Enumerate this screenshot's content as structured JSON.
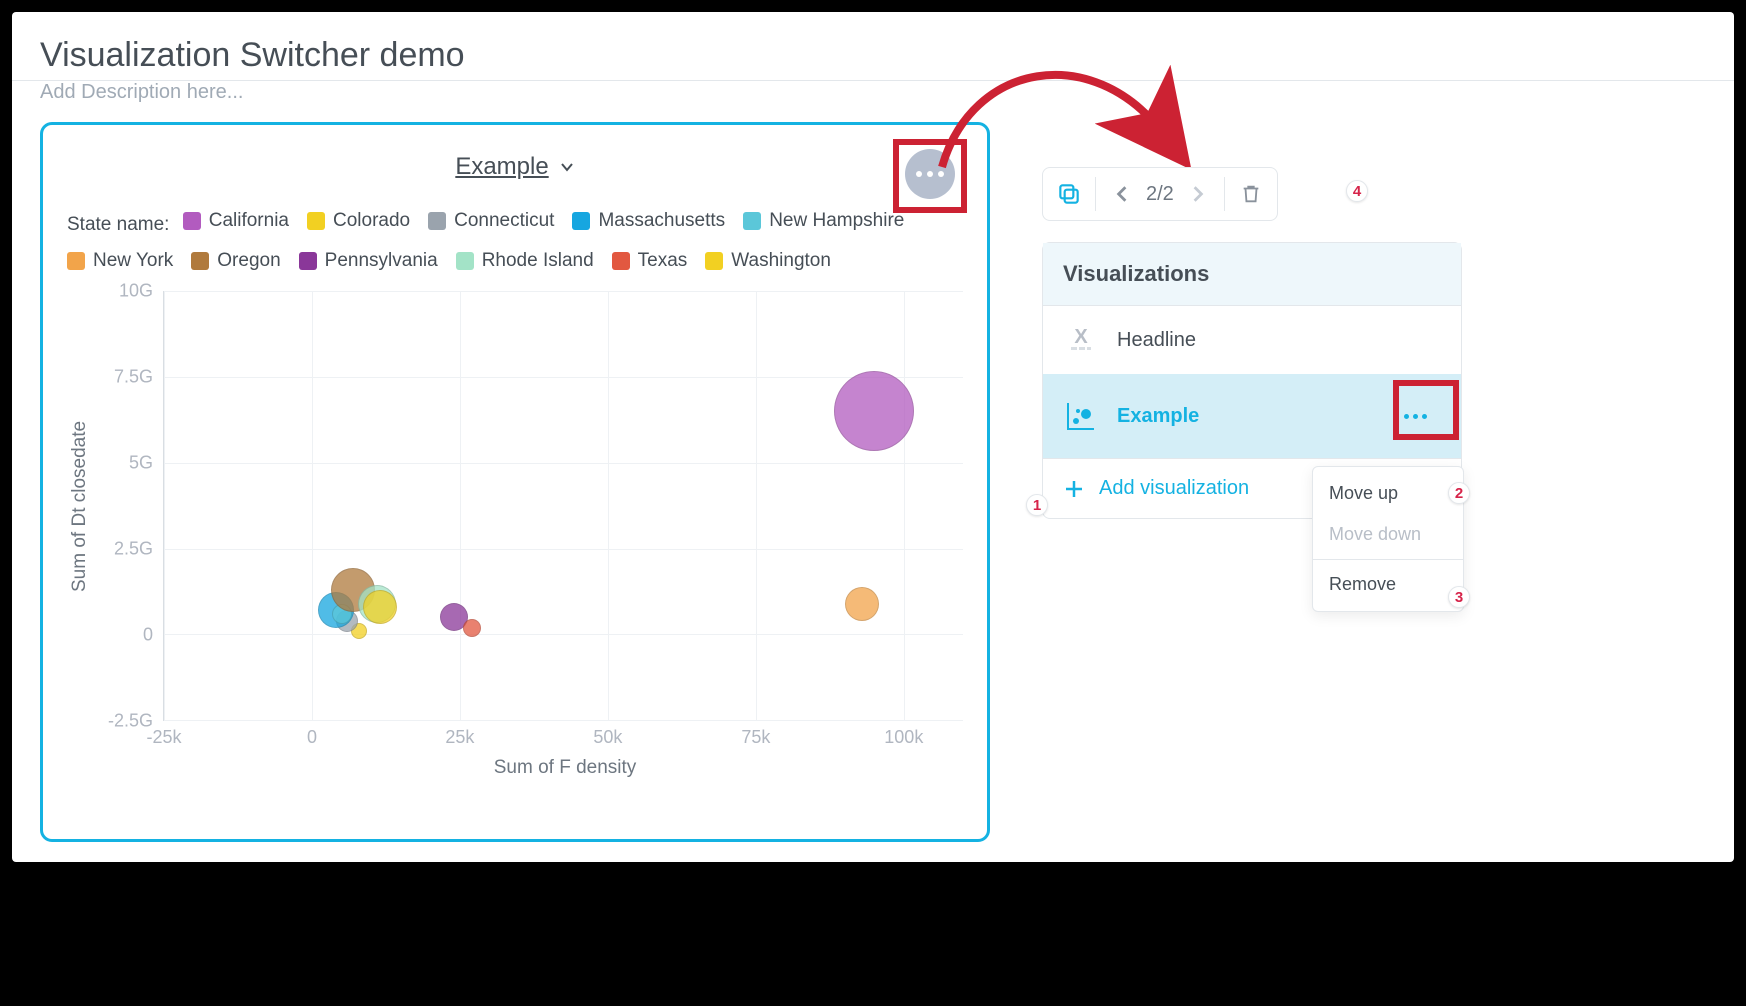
{
  "page": {
    "title": "Visualization Switcher demo",
    "description_placeholder": "Add Description here..."
  },
  "chartHeader": {
    "title": "Example"
  },
  "legend": {
    "label": "State name:",
    "items": [
      {
        "name": "California",
        "color": "#b25bbf"
      },
      {
        "name": "Colorado",
        "color": "#f2d022"
      },
      {
        "name": "Connecticut",
        "color": "#9aa3ad"
      },
      {
        "name": "Massachusetts",
        "color": "#16a6e0"
      },
      {
        "name": "New Hampshire",
        "color": "#5bc7d9"
      },
      {
        "name": "New York",
        "color": "#f2a44a"
      },
      {
        "name": "Oregon",
        "color": "#b07a3d"
      },
      {
        "name": "Pennsylvania",
        "color": "#8a3799"
      },
      {
        "name": "Rhode Island",
        "color": "#a3e3c7"
      },
      {
        "name": "Texas",
        "color": "#e25840"
      },
      {
        "name": "Washington",
        "color": "#f2d022"
      }
    ]
  },
  "toolbar": {
    "counter": "2/2"
  },
  "vizPanel": {
    "header": "Visualizations",
    "items": [
      {
        "label": "Headline",
        "type": "headline"
      },
      {
        "label": "Example",
        "type": "bubble",
        "active": true
      }
    ],
    "add_label": "Add visualization"
  },
  "contextMenu": {
    "move_up": "Move up",
    "move_down": "Move down",
    "remove": "Remove"
  },
  "callouts": {
    "c1": "1",
    "c2": "2",
    "c3": "3",
    "c4": "4"
  },
  "chart_data": {
    "type": "scatter",
    "title": "Example",
    "xlabel": "Sum of F density",
    "ylabel": "Sum of Dt closedate",
    "xlim": [
      -25000,
      110000
    ],
    "ylim": [
      -2500000000,
      10000000000
    ],
    "x_ticks": [
      {
        "v": -25000,
        "label": "-25k"
      },
      {
        "v": 0,
        "label": "0"
      },
      {
        "v": 25000,
        "label": "25k"
      },
      {
        "v": 50000,
        "label": "50k"
      },
      {
        "v": 75000,
        "label": "75k"
      },
      {
        "v": 100000,
        "label": "100k"
      }
    ],
    "y_ticks": [
      {
        "v": -2500000000,
        "label": "-2.5G"
      },
      {
        "v": 0,
        "label": "0"
      },
      {
        "v": 2500000000,
        "label": "2.5G"
      },
      {
        "v": 5000000000,
        "label": "5G"
      },
      {
        "v": 7500000000,
        "label": "7.5G"
      },
      {
        "v": 10000000000,
        "label": "10G"
      }
    ],
    "series": [
      {
        "name": "California",
        "color": "#b25bbf",
        "x": 95000,
        "y": 6500000000,
        "size": 80
      },
      {
        "name": "Colorado",
        "color": "#f2d022",
        "x": 8000,
        "y": 100000000,
        "size": 16
      },
      {
        "name": "Connecticut",
        "color": "#9aa3ad",
        "x": 6000,
        "y": 400000000,
        "size": 22
      },
      {
        "name": "Massachusetts",
        "color": "#16a6e0",
        "x": 4000,
        "y": 700000000,
        "size": 36
      },
      {
        "name": "New Hampshire",
        "color": "#5bc7d9",
        "x": 5000,
        "y": 600000000,
        "size": 20
      },
      {
        "name": "New York",
        "color": "#f2a44a",
        "x": 93000,
        "y": 900000000,
        "size": 34
      },
      {
        "name": "Oregon",
        "color": "#b07a3d",
        "x": 7000,
        "y": 1300000000,
        "size": 44
      },
      {
        "name": "Pennsylvania",
        "color": "#8a3799",
        "x": 24000,
        "y": 500000000,
        "size": 28
      },
      {
        "name": "Rhode Island",
        "color": "#a3e3c7",
        "x": 11000,
        "y": 900000000,
        "size": 38
      },
      {
        "name": "Texas",
        "color": "#e25840",
        "x": 27000,
        "y": 200000000,
        "size": 18
      },
      {
        "name": "Washington",
        "color": "#f2d022",
        "x": 11500,
        "y": 800000000,
        "size": 34
      }
    ]
  }
}
